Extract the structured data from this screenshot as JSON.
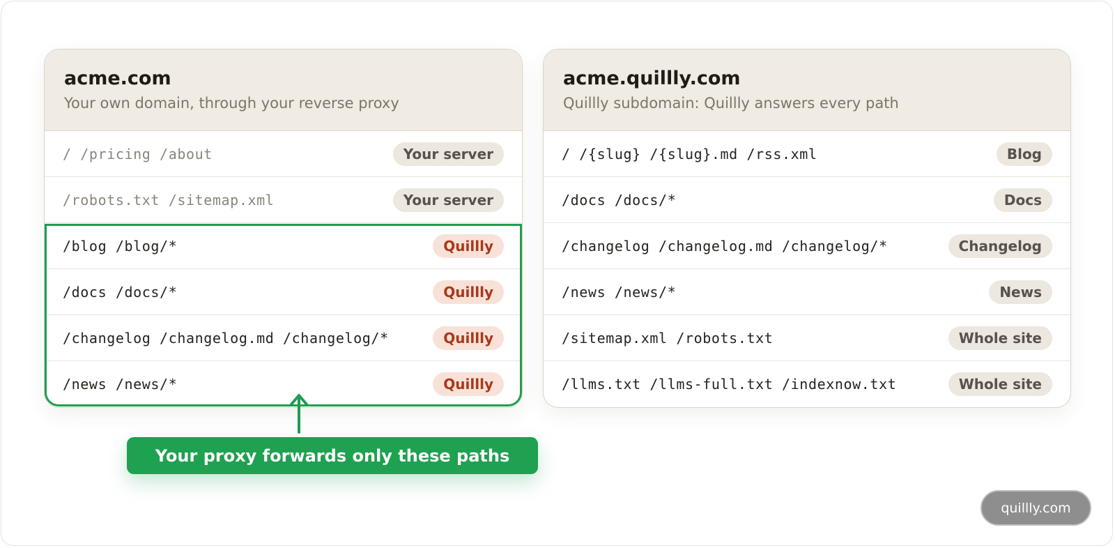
{
  "left_panel": {
    "title": "acme.com",
    "subtitle": "Your own domain, through your reverse proxy",
    "rows": [
      {
        "path": "/ /pricing /about",
        "badge": "Your server"
      },
      {
        "path": "/robots.txt /sitemap.xml",
        "badge": "Your server"
      },
      {
        "path": "/blog /blog/*",
        "badge": "Quillly"
      },
      {
        "path": "/docs /docs/*",
        "badge": "Quillly"
      },
      {
        "path": "/changelog /changelog.md /changelog/*",
        "badge": "Quillly"
      },
      {
        "path": "/news /news/*",
        "badge": "Quillly"
      }
    ]
  },
  "right_panel": {
    "title": "acme.quillly.com",
    "subtitle": "Quillly subdomain: Quillly answers every path",
    "rows": [
      {
        "path": "/ /{slug} /{slug}.md /rss.xml",
        "badge": "Blog"
      },
      {
        "path": "/docs /docs/*",
        "badge": "Docs"
      },
      {
        "path": "/changelog /changelog.md /changelog/*",
        "badge": "Changelog"
      },
      {
        "path": "/news /news/*",
        "badge": "News"
      },
      {
        "path": "/sitemap.xml /robots.txt",
        "badge": "Whole site"
      },
      {
        "path": "/llms.txt /llms-full.txt /indexnow.txt",
        "badge": "Whole site"
      }
    ]
  },
  "callout": {
    "label": "Your proxy forwards only these paths"
  },
  "brand": {
    "label": "quillly.com"
  },
  "colors": {
    "accent_green": "#1ea150",
    "quillly_badge_text": "#a8391a",
    "quillly_badge_bg": "#f8e1d8",
    "neutral_badge_bg": "#ece7df"
  }
}
